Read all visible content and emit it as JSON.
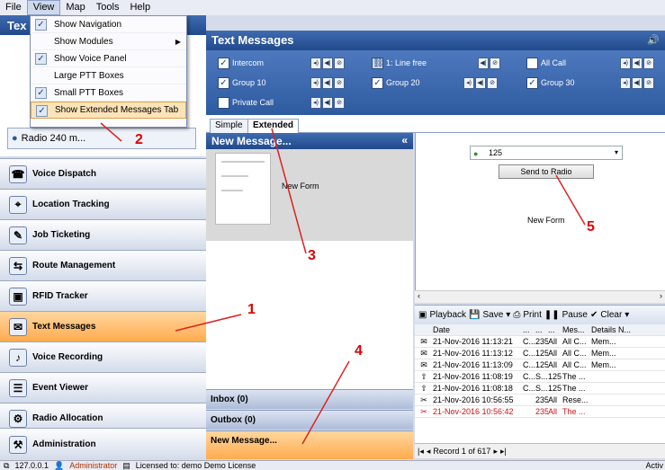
{
  "menubar": {
    "items": [
      "File",
      "View",
      "Map",
      "Tools",
      "Help"
    ]
  },
  "left": {
    "header": "Tex",
    "radio_label": "Radio 240 m...",
    "nav": [
      {
        "label": "Voice Dispatch",
        "icon": "dispatch-icon"
      },
      {
        "label": "Location Tracking",
        "icon": "map-icon"
      },
      {
        "label": "Job Ticketing",
        "icon": "job-icon"
      },
      {
        "label": "Route Management",
        "icon": "route-icon"
      },
      {
        "label": "RFID Tracker",
        "icon": "rfid-icon"
      },
      {
        "label": "Text Messages",
        "icon": "mail-icon"
      },
      {
        "label": "Voice Recording",
        "icon": "mic-icon"
      },
      {
        "label": "Event Viewer",
        "icon": "event-icon"
      },
      {
        "label": "Radio Allocation",
        "icon": "allocation-icon"
      },
      {
        "label": "Administration",
        "icon": "admin-icon"
      }
    ]
  },
  "view_menu": [
    {
      "label": "Show Navigation",
      "checked": true
    },
    {
      "label": "Show Modules",
      "checked": false,
      "submenu": true
    },
    {
      "label": "Show Voice Panel",
      "checked": true
    },
    {
      "label": "Large PTT Boxes",
      "checked": false
    },
    {
      "label": "Small PTT Boxes",
      "checked": true
    },
    {
      "label": "Show Extended Messages Tab",
      "checked": true
    }
  ],
  "main": {
    "title": "Text Messages",
    "talkgroups": [
      {
        "label": "Intercom",
        "checked": true
      },
      {
        "label": "1: Line free",
        "checked": false
      },
      {
        "label": "All Call",
        "checked": false
      },
      {
        "label": "Group 10",
        "checked": true
      },
      {
        "label": "Group 20",
        "checked": true
      },
      {
        "label": "Group 30",
        "checked": true
      },
      {
        "label": "Private Call",
        "checked": false
      }
    ],
    "tabs": [
      "Simple",
      "Extended"
    ]
  },
  "new_message": {
    "title": "New Message...",
    "form_label": "New Form",
    "collapse": "«",
    "bars": [
      "Inbox (0)",
      "Outbox (0)",
      "New Message..."
    ]
  },
  "right": {
    "radio_select": "125",
    "send_button": "Send to Radio",
    "form_label": "New Form",
    "toolbar": [
      "Playback",
      "Save",
      "Print",
      "Pause",
      "Clear"
    ],
    "columns": [
      "Date",
      "...",
      "...",
      "...",
      "Mes...",
      "Details",
      "N..."
    ],
    "rows": [
      [
        "21-Nov-2016 11:13:21",
        "C...",
        "235",
        "All",
        "All C...",
        "Mem...",
        ""
      ],
      [
        "21-Nov-2016 11:13:12",
        "C...",
        "125",
        "All",
        "All C...",
        "Mem...",
        ""
      ],
      [
        "21-Nov-2016 11:13:09",
        "C...",
        "125",
        "All",
        "All C...",
        "Mem...",
        ""
      ],
      [
        "21-Nov-2016 11:08:19",
        "C...",
        "S...",
        "125",
        "The ...",
        "",
        ""
      ],
      [
        "21-Nov-2016 11:08:18",
        "C...",
        "S...",
        "125",
        "The ...",
        "",
        ""
      ],
      [
        "21-Nov-2016 10:56:55",
        "",
        "235",
        "All",
        "Rese...",
        "",
        ""
      ],
      [
        "21-Nov-2016 10:56:42",
        "",
        "235",
        "All",
        "The ...",
        "",
        ""
      ]
    ],
    "pager": "Record 1 of 617"
  },
  "status": {
    "ip": "127.0.0.1",
    "user": "Administrator",
    "license": "Licensed to: demo Demo License",
    "active": "Activ"
  },
  "annotations": [
    "1",
    "2",
    "3",
    "4",
    "5"
  ],
  "colors": {
    "header": "#214a8c",
    "selected": "#ffab4e",
    "annotation": "#dd0000"
  }
}
